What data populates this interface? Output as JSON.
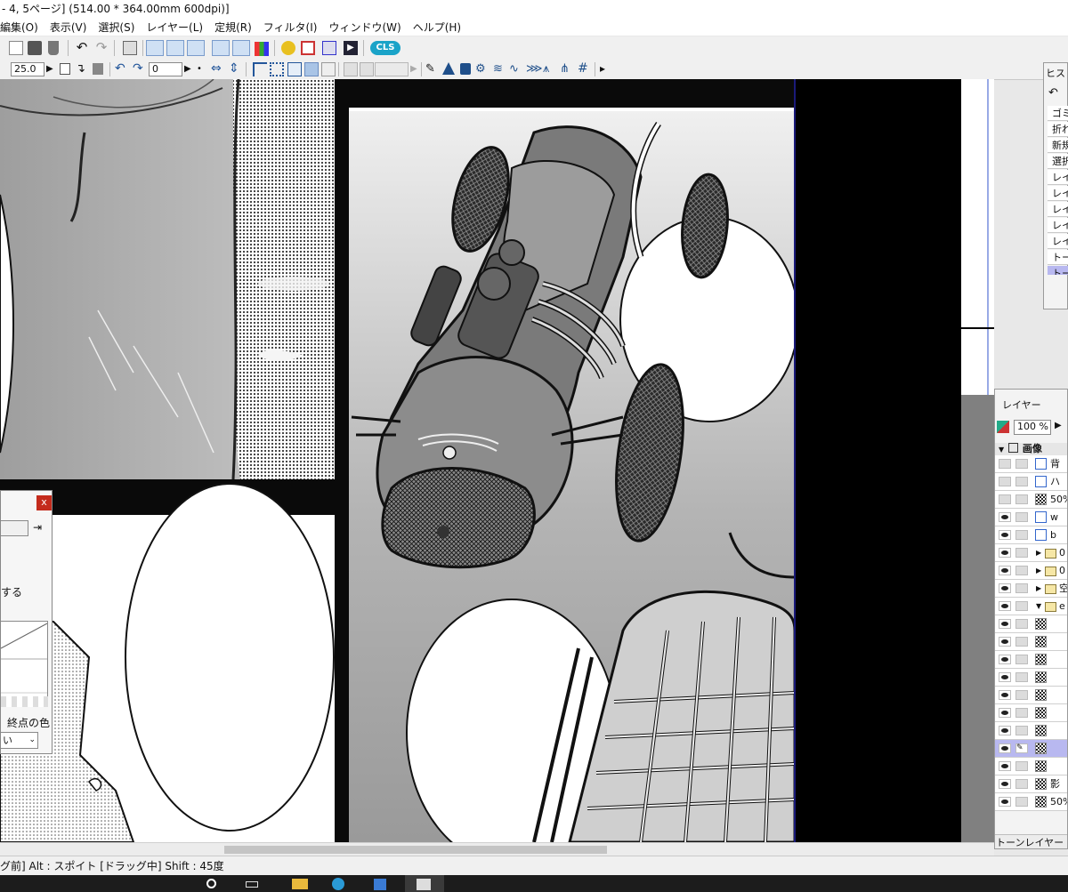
{
  "window": {
    "title": "- 4, 5ページ] (514.00 * 364.00mm 600dpi)]"
  },
  "menu": {
    "items": [
      "編集(O)",
      "表示(V)",
      "選択(S)",
      "レイヤー(L)",
      "定規(R)",
      "フィルタ(I)",
      "ウィンドウ(W)",
      "ヘルプ(H)"
    ]
  },
  "toolbar": {
    "zoom_value": "25.0",
    "rotate_value": "0",
    "cls_label": "CLS",
    "icons": [
      "copy-icon",
      "paste-icon",
      "clear-icon",
      "undo-icon",
      "redo-icon",
      "print-icon",
      "layer-panel-icon",
      "tool-panel-icon",
      "navigator-icon",
      "properties-icon",
      "color-icon",
      "search-icon",
      "window-icon",
      "page-icon",
      "play-icon"
    ]
  },
  "history_panel": {
    "title": "ヒス",
    "items": [
      "ゴミ",
      "折れ",
      "新規",
      "選択",
      "レイ",
      "レイ",
      "レイ",
      "レイ",
      "レイ",
      "トー",
      "トー"
    ],
    "selected_index": 10
  },
  "layer_panel": {
    "title": "レイヤー",
    "opacity": "100 %",
    "group_label": "画像",
    "footer_label": "トーンレイヤー",
    "layers": [
      {
        "name": "背",
        "type": "raster",
        "visible": false
      },
      {
        "name": "ハ",
        "type": "raster",
        "visible": false
      },
      {
        "name": "50%",
        "type": "tone",
        "visible": false
      },
      {
        "name": "w",
        "type": "raster",
        "visible": true
      },
      {
        "name": "b",
        "type": "raster",
        "visible": true
      },
      {
        "name": "0",
        "type": "folder",
        "visible": true
      },
      {
        "name": "0",
        "type": "folder",
        "visible": true
      },
      {
        "name": "空",
        "type": "folder",
        "visible": true
      },
      {
        "name": "e",
        "type": "folder-open",
        "visible": true
      },
      {
        "name": "",
        "type": "tone",
        "visible": true
      },
      {
        "name": "",
        "type": "tone",
        "visible": true
      },
      {
        "name": "",
        "type": "tone",
        "visible": true
      },
      {
        "name": "",
        "type": "tone",
        "visible": true
      },
      {
        "name": "",
        "type": "tone",
        "visible": true
      },
      {
        "name": "",
        "type": "tone",
        "visible": true
      },
      {
        "name": "",
        "type": "tone",
        "visible": true
      },
      {
        "name": "",
        "type": "tone",
        "visible": true,
        "selected": true
      },
      {
        "name": "",
        "type": "tone",
        "visible": true
      },
      {
        "name": "影",
        "type": "tone",
        "visible": true
      },
      {
        "name": "50%",
        "type": "tone",
        "visible": true
      }
    ]
  },
  "gradient_dialog": {
    "close_label": "x",
    "fragment_text": "する",
    "end_color_label": "終点の色",
    "select_value": "い"
  },
  "status": {
    "text": "グ前] Alt : スポイト [ドラッグ中] Shift : 45度"
  }
}
